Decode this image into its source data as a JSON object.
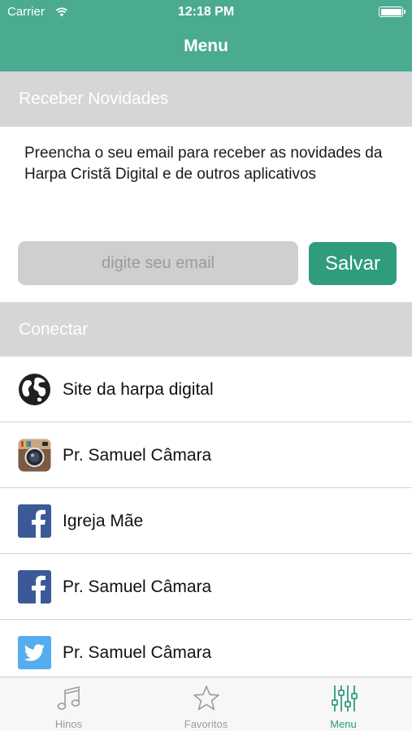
{
  "status_bar": {
    "carrier": "Carrier",
    "time": "12:18 PM"
  },
  "nav": {
    "title": "Menu"
  },
  "newsletter": {
    "header": "Receber Novidades",
    "description": "Preencha o seu email para receber as novidades da Harpa Cristã Digital e de outros aplicativos",
    "email_placeholder": "digite seu email",
    "email_value": "",
    "save_label": "Salvar"
  },
  "connect": {
    "header": "Conectar",
    "items": [
      {
        "label": "Site da harpa digital",
        "icon": "globe-icon"
      },
      {
        "label": "Pr. Samuel Câmara",
        "icon": "instagram-icon"
      },
      {
        "label": "Igreja Mãe",
        "icon": "facebook-icon"
      },
      {
        "label": "Pr. Samuel Câmara",
        "icon": "facebook-icon"
      },
      {
        "label": "Pr. Samuel Câmara",
        "icon": "twitter-icon"
      }
    ]
  },
  "tabbar": {
    "tabs": [
      {
        "label": "Hinos",
        "icon": "music-note-icon",
        "active": false
      },
      {
        "label": "Favoritos",
        "icon": "star-icon",
        "active": false
      },
      {
        "label": "Menu",
        "icon": "sliders-icon",
        "active": true
      }
    ]
  },
  "colors": {
    "header_bg": "#4aab91",
    "accent": "#2f9c7e",
    "section_header_bg": "#d6d6d6",
    "facebook_blue": "#3b5998",
    "twitter_blue": "#55acee"
  }
}
